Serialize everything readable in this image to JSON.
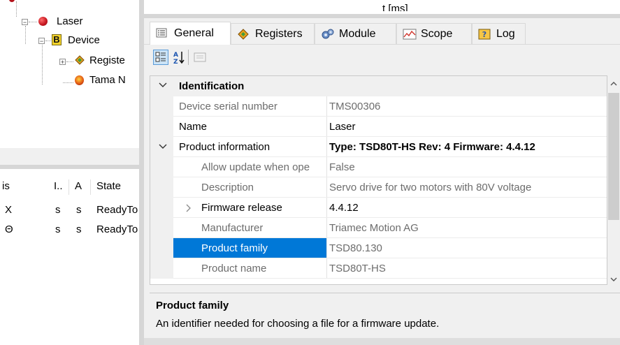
{
  "top_text": "t [ms]",
  "tree": {
    "nodes": [
      {
        "label": "Laser",
        "icon": "red-dot-icon"
      },
      {
        "label": "Device",
        "icon": "b-device-icon"
      },
      {
        "label": "Registe",
        "icon": "registers-icon"
      },
      {
        "label": "Tama N",
        "icon": "tama-icon"
      }
    ],
    "scroll_right": "›"
  },
  "axes_grid": {
    "headers": [
      "is",
      "I..",
      "A",
      "State"
    ],
    "rows": [
      [
        "X",
        "s",
        "s",
        "ReadyTo"
      ],
      [
        "Θ",
        "s",
        "s",
        "ReadyTo"
      ]
    ]
  },
  "tabs": [
    {
      "label": "General",
      "icon": "list-icon",
      "active": true
    },
    {
      "label": "Registers",
      "icon": "registers-icon",
      "active": false
    },
    {
      "label": "Module",
      "icon": "gears-icon",
      "active": false
    },
    {
      "label": "Scope",
      "icon": "scope-icon",
      "active": false
    },
    {
      "label": "Log",
      "icon": "log-icon",
      "active": false
    }
  ],
  "toolbar": {
    "categorized": "categorized-view-icon",
    "alphabetical": "alphabetical-sort-icon",
    "pages": "property-pages-icon",
    "sort_glyph": "A Z"
  },
  "properties": {
    "identification": {
      "category": "Identification",
      "device_serial_number": {
        "name": "Device serial number",
        "value": "TMS00306"
      },
      "name": {
        "name": "Name",
        "value": "Laser"
      }
    },
    "product_information": {
      "category": "Product information",
      "summary": "Type: TSD80T-HS Rev: 4 Firmware: 4.4.12",
      "allow_update": {
        "name": "Allow update when ope",
        "value": "False"
      },
      "description": {
        "name": "Description",
        "value": "Servo drive for two motors with 80V voltage"
      },
      "firmware_release": {
        "name": "Firmware release",
        "value": "4.4.12"
      },
      "manufacturer": {
        "name": "Manufacturer",
        "value": "Triamec Motion AG"
      },
      "product_family": {
        "name": "Product family",
        "value": "TSD80.130"
      },
      "product_name": {
        "name": "Product name",
        "value": "TSD80T-HS"
      }
    }
  },
  "help": {
    "title": "Product family",
    "text": "An identifier needed for choosing a file for a firmware update."
  },
  "colors": {
    "selection": "#0078d7",
    "splitter": "#d6d6d6",
    "gutter": "#f0f0f0",
    "grey_text": "#6d6d6d"
  }
}
